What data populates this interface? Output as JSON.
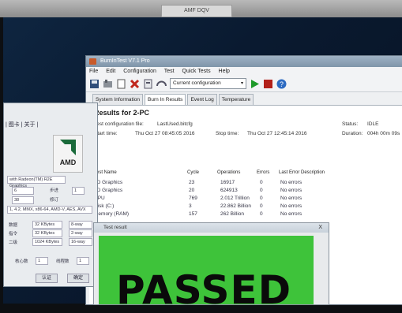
{
  "bezel": {
    "label": "AMF DQV"
  },
  "main_window": {
    "title": "BurnInTest V7.1 Pro",
    "menu": [
      "File",
      "Edit",
      "Configuration",
      "Test",
      "Quick Tests",
      "Help"
    ],
    "toolbar": {
      "config_select": "Current configuration"
    },
    "tabs": [
      "System Information",
      "Burn In Results",
      "Event Log",
      "Temperature"
    ],
    "results": {
      "title": "Results for 2-PC",
      "config_file_label": "Test configuration file:",
      "config_file_value": "LastUsed.bitcfg",
      "start_label": "Start time:",
      "start_value": "Thu Oct 27 08:45:05 2016",
      "stop_label": "Stop time:",
      "stop_value": "Thu Oct 27 12:45:14 2016",
      "status_label": "Status:",
      "status_value": "IDLE",
      "duration_label": "Duration:",
      "duration_value": "004h 00m 09s",
      "columns": [
        "Test Name",
        "Cycle",
        "Operations",
        "Errors",
        "Last Error Description"
      ],
      "rows": [
        {
          "name": "2D Graphics",
          "cycle": "23",
          "ops": "16917",
          "errors": "0",
          "desc": "No errors"
        },
        {
          "name": "3D Graphics",
          "cycle": "20",
          "ops": "624913",
          "errors": "0",
          "desc": "No errors"
        },
        {
          "name": "CPU",
          "cycle": "769",
          "ops": "2.012 Trillion",
          "errors": "0",
          "desc": "No errors"
        },
        {
          "name": "Disk (C:)",
          "cycle": "3",
          "ops": "22.862 Billion",
          "errors": "0",
          "desc": "No errors"
        },
        {
          "name": "Memory (RAM)",
          "cycle": "157",
          "ops": "262 Billion",
          "errors": "0",
          "desc": "No errors"
        }
      ]
    }
  },
  "cpuz": {
    "tabs": "| 图卡 | 关于 |",
    "gpu_name": "with Radeon(TM) R2E Graphics",
    "field1": "6",
    "step_label": "步进",
    "step_value": "1",
    "field2": "38",
    "rev_label": "修订",
    "instructions": "1, 4.2, MMX, x86-64, AMD-V, AES, AVX",
    "cache_rows": [
      {
        "label": "数据",
        "size": "32 KBytes",
        "way": "8-way"
      },
      {
        "label": "指令",
        "size": "32 KBytes",
        "way": "2-way"
      },
      {
        "label": "二级",
        "size": "1024 KBytes",
        "way": "16-way"
      }
    ],
    "cores_label": "核心数",
    "cores_value": "1",
    "threads_label": "线程数",
    "threads_value": "1",
    "ok_label": "认证",
    "confirm_label": "确定",
    "logo_text": "AMD"
  },
  "popup": {
    "title": "Test result",
    "close": "X",
    "result_text": "PASSED",
    "result_color": "#3ec33a"
  }
}
